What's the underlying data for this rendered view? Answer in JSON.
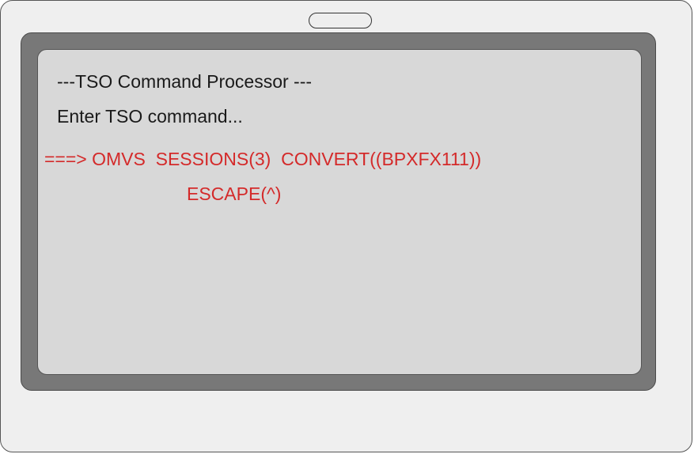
{
  "terminal": {
    "header": "---TSO Command Processor ---",
    "prompt": "Enter TSO command...",
    "command_line_1": "===> OMVS  SESSIONS(3)  CONVERT((BPXFX111))",
    "command_line_2": "ESCAPE(^)"
  },
  "colors": {
    "text": "#1a1a1a",
    "command": "#d42a2a",
    "screen": "#d8d8d8",
    "bezel": "#787878",
    "frame": "#efefef"
  }
}
